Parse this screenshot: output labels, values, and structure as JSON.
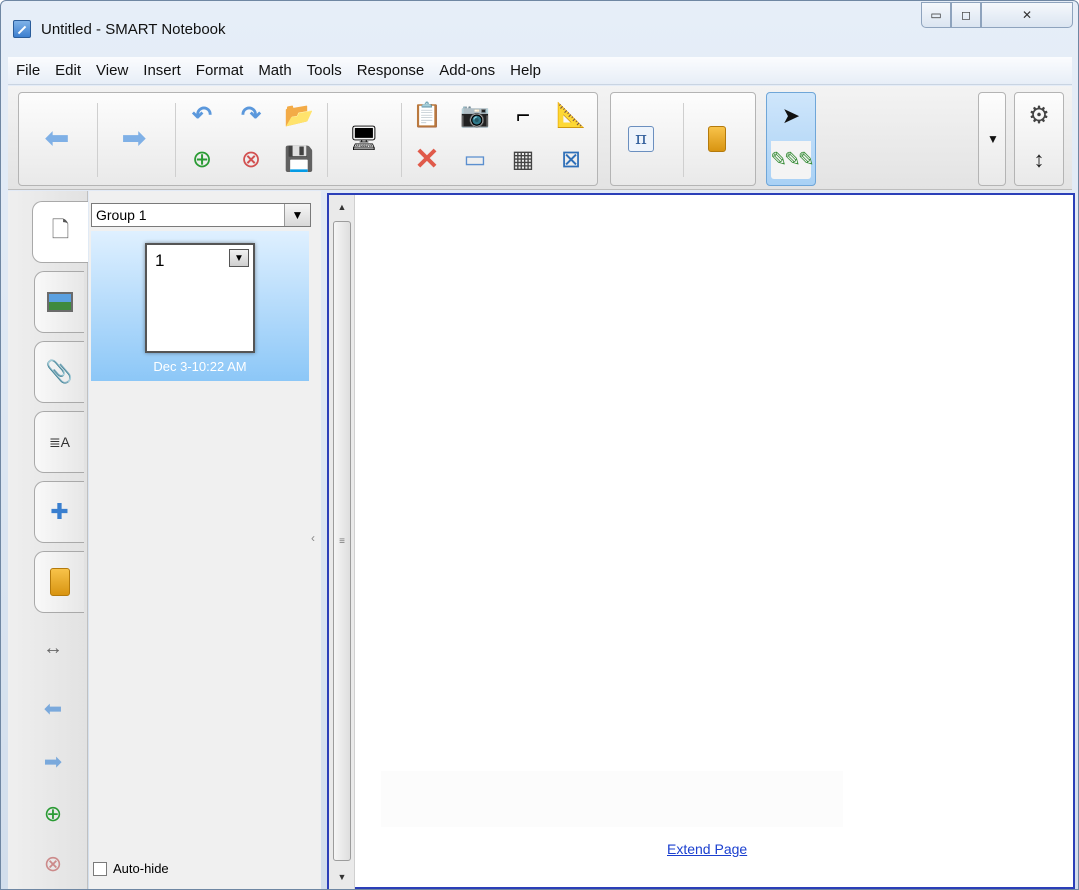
{
  "window": {
    "title": "Untitled - SMART Notebook",
    "controls": {
      "minimize": "▭",
      "maximize": "◻",
      "close": "✕"
    }
  },
  "menu": [
    "File",
    "Edit",
    "View",
    "Insert",
    "Format",
    "Math",
    "Tools",
    "Response",
    "Add-ons",
    "Help"
  ],
  "toolbar": {
    "icons": {
      "back": "arrow-left-icon",
      "forward": "arrow-right-icon",
      "undo": "undo-icon",
      "redo": "redo-icon",
      "open": "open-folder-icon",
      "new_page": "add-page-icon",
      "delete_page": "delete-page-icon",
      "save": "save-icon",
      "screen": "screen-share-icon",
      "paste": "paste-icon",
      "capture": "screen-capture-icon",
      "document_camera": "document-camera-icon",
      "measure": "measurement-tools-icon",
      "delete": "delete-icon",
      "screen_shade": "screen-shade-icon",
      "table": "table-icon",
      "full_screen": "full-screen-icon",
      "math": "math-icon",
      "response": "response-icon",
      "select": "select-icon",
      "pens": "pens-icon",
      "more": "dropdown-icon",
      "settings": "gear-icon",
      "move_toolbar": "move-toolbar-icon"
    },
    "glyphs": {
      "back": "⬅",
      "forward": "➡",
      "undo": "↶",
      "redo": "↷",
      "open": "📂",
      "new_page": "⊕",
      "delete_page": "⊗",
      "save": "💾",
      "screen": "🖥",
      "paste": "📋",
      "capture": "📷",
      "document_camera": "⌐",
      "measure": "📐",
      "delete": "✕",
      "screen_shade": "▭",
      "table": "▦",
      "full_screen": "⊠",
      "math": "π",
      "cursor": "➤",
      "pens": "✎✎✎",
      "more": "▼",
      "gear": "⚙",
      "updown": "↕"
    }
  },
  "side_tabs": [
    "page-sorter",
    "gallery",
    "attachments",
    "properties",
    "add-ons",
    "response"
  ],
  "side_glyphs": {
    "page": "🗋",
    "attach": "📎",
    "props": "≣A",
    "addons": "✚",
    "swap": "↔",
    "back": "⬅",
    "forward": "➡",
    "add": "⊕",
    "del": "⊗"
  },
  "sorter": {
    "group": "Group 1",
    "dropdown_glyph": "▼",
    "page_number": "1",
    "page_date": "Dec 3-10:22 AM",
    "autohide_label": "Auto-hide"
  },
  "scrollbar": {
    "up": "▲",
    "down": "▼",
    "grip": "≡"
  },
  "canvas": {
    "extend_label": "Extend Page"
  },
  "colors": {
    "accent": "#2b3fb8",
    "link": "#1a3fcf",
    "selection": "#a9d1f5"
  }
}
